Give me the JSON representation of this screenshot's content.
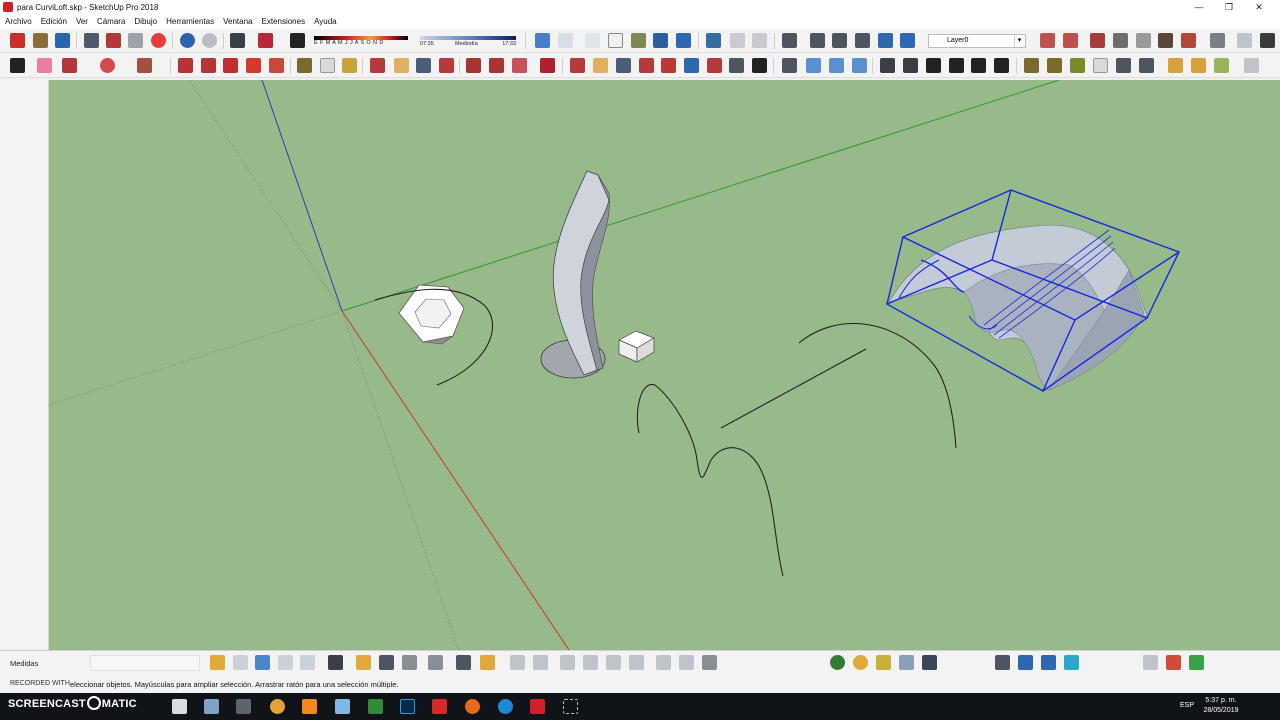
{
  "window": {
    "title": "para CurviLoft.skp - SketchUp Pro 2018",
    "buttons": [
      "—",
      "❐",
      "✕"
    ]
  },
  "menus": [
    "Archivo",
    "Edición",
    "Ver",
    "Cámara",
    "Dibujo",
    "Herramientas",
    "Ventana",
    "Extensiones",
    "Ayuda"
  ],
  "shadow_settings": {
    "months": "E F M A M J J A S O N D",
    "time_start": "07:35",
    "time_mid": "Mediodía",
    "time_end": "17:33"
  },
  "layer": {
    "current": "Layer0"
  },
  "colors": {
    "viewport_bg": "#98b98a",
    "axis_red": "#c73a2e",
    "axis_green": "#2f9a2f",
    "axis_blue": "#2c3fb3",
    "selection_blue": "#1428e0",
    "toolbar_bg": "#f3f3f3",
    "taskbar_bg": "#101318"
  },
  "measurements": {
    "label": "Medidas",
    "value": ""
  },
  "status": {
    "recorded_with": "RECORDED WITH",
    "hint": "eleccionar objetos. Mayúsculas para ampliar selección. Arrastrar ratón para una selección múltiple."
  },
  "taskbar": {
    "brand": "SCREENCAST",
    "brand_suffix": "MATIC",
    "language": "ESP",
    "time": "5:37 p. m.",
    "date": "28/05/2019",
    "apps": [
      "windows-icon",
      "search-icon",
      "task-view-icon",
      "edge-icon",
      "store-icon",
      "settings-icon",
      "media-icon",
      "chrome-icon",
      "vlc-icon",
      "app-icon",
      "excel-icon",
      "photoshop-icon",
      "acrobat-icon",
      "firefox-icon",
      "ie-icon",
      "sketchup-icon",
      "snipping-icon"
    ]
  }
}
